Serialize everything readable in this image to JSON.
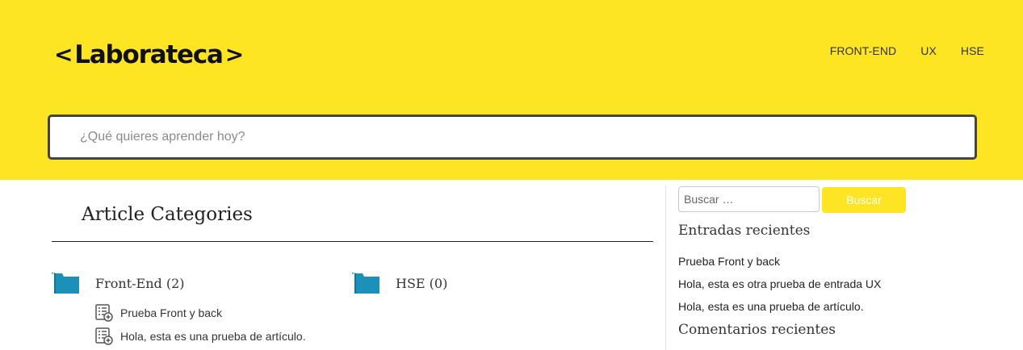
{
  "header": {
    "logo": {
      "left": "<",
      "text": "Laborateca",
      "right": ">"
    },
    "nav": [
      "FRONT-END",
      "UX",
      "HSE"
    ],
    "search_placeholder": "¿Qué quieres aprender hoy?"
  },
  "main": {
    "title": "Article Categories",
    "categories": [
      {
        "label": "Front-End (2)",
        "articles": [
          "Prueba Front y back",
          "Hola, esta es una prueba de artículo."
        ]
      },
      {
        "label": "HSE (0)",
        "articles": []
      }
    ]
  },
  "sidebar": {
    "search_placeholder": "Buscar …",
    "search_button": "Buscar",
    "recent_posts_title": "Entradas recientes",
    "recent_posts": [
      "Prueba Front y back",
      "Hola, esta es otra prueba de entrada UX",
      "Hola, esta es una prueba de artículo."
    ],
    "recent_comments_title": "Comentarios recientes"
  },
  "colors": {
    "header_bg": "#fde523",
    "folder_icon": "#1b90b8",
    "button_bg": "#fde523"
  }
}
